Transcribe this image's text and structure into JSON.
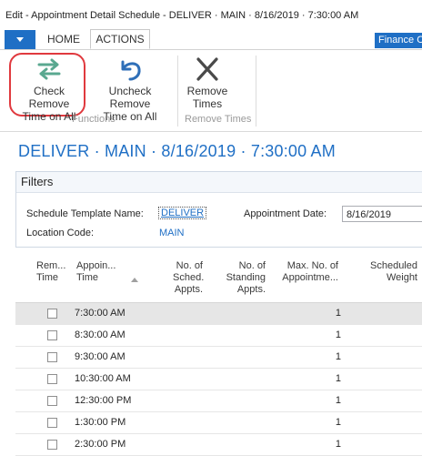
{
  "window": {
    "title": "Edit - Appointment Detail Schedule - DELIVER · MAIN · 8/16/2019 · 7:30:00 AM"
  },
  "tabs": {
    "home": "HOME",
    "actions": "ACTIONS",
    "finance": "Finance Co"
  },
  "ribbon": {
    "check_remove_l1": "Check Remove",
    "check_remove_l2": "Time on All",
    "uncheck_remove_l1": "Uncheck Remove",
    "uncheck_remove_l2": "Time on All",
    "remove_times_l1": "Remove",
    "remove_times_l2": "Times",
    "group_functions": "Functions",
    "group_remove_times": "Remove Times"
  },
  "page_title": "DELIVER · MAIN · 8/16/2019 · 7:30:00 AM",
  "filters": {
    "header": "Filters",
    "template_label": "Schedule Template Name:",
    "template_value": "DELIVER",
    "location_label": "Location Code:",
    "location_value": "MAIN",
    "date_label": "Appointment Date:",
    "date_value": "8/16/2019"
  },
  "grid": {
    "columns": {
      "c1l1": "Rem...",
      "c1l2": "Time",
      "c2l1": "Appoin...",
      "c2l2": "Time",
      "c3l1": "No. of",
      "c3l2": "Sched.",
      "c3l3": "Appts.",
      "c4l1": "No. of",
      "c4l2": "Standing",
      "c4l3": "Appts.",
      "c5l1": "Max. No. of",
      "c5l2": "Appointme...",
      "c6l1": "Scheduled",
      "c6l2": "Weight"
    },
    "rows": [
      {
        "time": "7:30:00 AM",
        "max": "1",
        "remove": false
      },
      {
        "time": "8:30:00 AM",
        "max": "1",
        "remove": false
      },
      {
        "time": "9:30:00 AM",
        "max": "1",
        "remove": false
      },
      {
        "time": "10:30:00 AM",
        "max": "1",
        "remove": false
      },
      {
        "time": "12:30:00 PM",
        "max": "1",
        "remove": false
      },
      {
        "time": "1:30:00 PM",
        "max": "1",
        "remove": false
      },
      {
        "time": "2:30:00 PM",
        "max": "1",
        "remove": false
      }
    ]
  },
  "colors": {
    "accent": "#1f6fc5",
    "highlight": "#e0393e",
    "check_icon": "#5aa890",
    "uncheck_icon": "#2f6fb8"
  }
}
